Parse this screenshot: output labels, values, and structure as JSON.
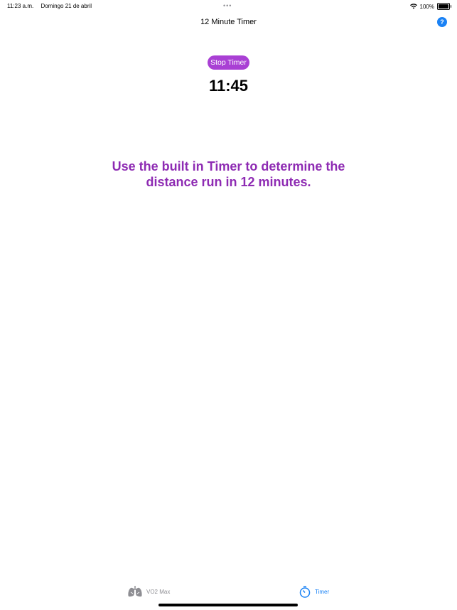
{
  "status_bar": {
    "time": "11:23 a.m.",
    "date": "Domingo 21 de abril",
    "battery": "100%",
    "icons": [
      "wifi-icon",
      "battery-icon"
    ]
  },
  "nav": {
    "title": "12 Minute Timer",
    "help_label": "?"
  },
  "timer": {
    "stop_label": "Stop Timer",
    "display": "11:45"
  },
  "instruction": "Use the built in Timer to determine the distance run in 12 minutes.",
  "tabs": [
    {
      "label": "VO2 Max",
      "icon": "lungs-icon",
      "selected": false
    },
    {
      "label": "Timer",
      "icon": "timer-icon",
      "selected": true
    }
  ],
  "colors": {
    "accent_purple": "#a940d4",
    "instruction_purple": "#8e2bb3",
    "tint_blue": "#1a82f5",
    "inactive_gray": "#8e8e93"
  }
}
